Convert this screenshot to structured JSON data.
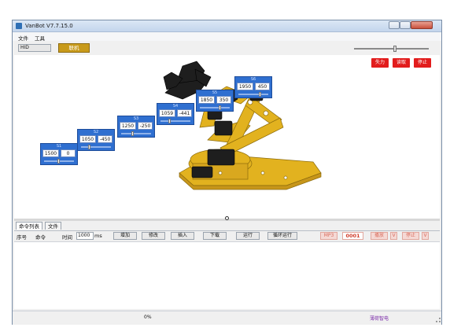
{
  "window": {
    "title": "VanBot V7.7.15.0"
  },
  "menu": [
    "文件",
    "工具"
  ],
  "toolbar": {
    "port": "HID",
    "connect_label": "联机"
  },
  "controls": {
    "unload": "失力",
    "readback": "读取",
    "stop": "停止"
  },
  "servos": [
    {
      "id": "S1",
      "pos": 1500,
      "offset": 0
    },
    {
      "id": "S2",
      "pos": 1050,
      "offset": -450
    },
    {
      "id": "S3",
      "pos": 1250,
      "offset": -250
    },
    {
      "id": "S4",
      "pos": 1059,
      "offset": -441
    },
    {
      "id": "S5",
      "pos": 1850,
      "offset": 350
    },
    {
      "id": "S6",
      "pos": 1950,
      "offset": 450
    }
  ],
  "tabs": [
    "命令列表",
    "文件"
  ],
  "command_bar": {
    "col_index": "序号",
    "col_command": "命令",
    "time_label": "时间",
    "time_value": "1000",
    "time_unit": "ms",
    "add": "增加",
    "modify": "修改",
    "insert": "插入",
    "download": "下载",
    "run": "运行",
    "loop_run": "循环运行",
    "mp3": "MP3",
    "track": "0001",
    "play": "播放",
    "play_v": "V",
    "pause": "停止",
    "pause_v": "V"
  },
  "status": {
    "progress_text": "0%",
    "brand": "薄荷智电"
  },
  "colors": {
    "accent_gold": "#c89a1a",
    "servo_blue": "#2f6fd0",
    "danger_red": "#e21d1d"
  }
}
